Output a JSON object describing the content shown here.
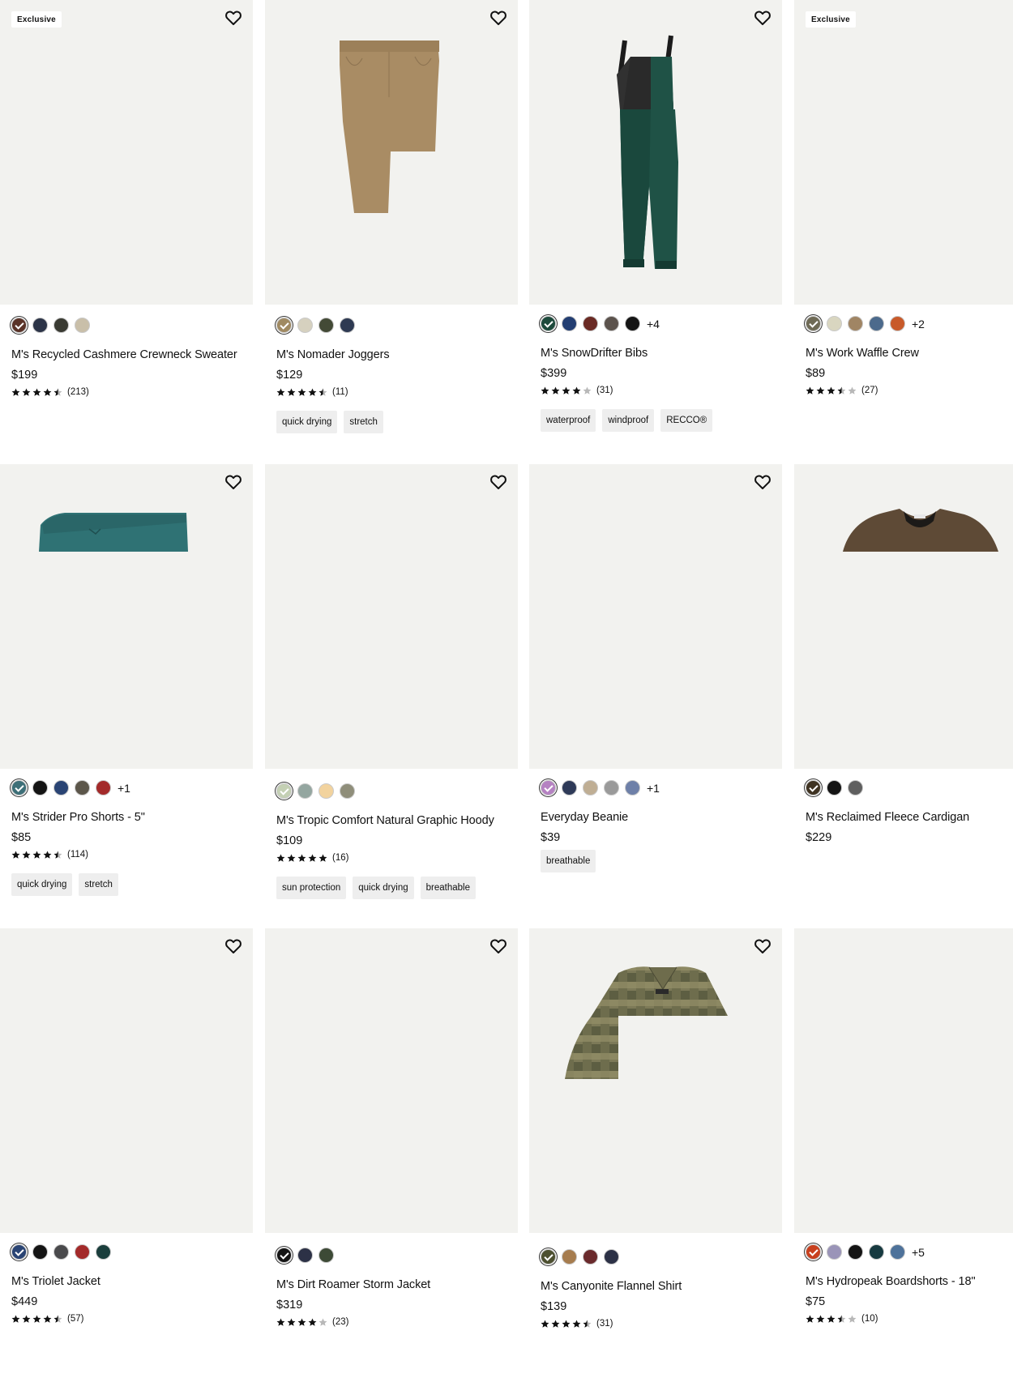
{
  "products": [
    {
      "badge": "Exclusive",
      "name": "M's Recycled Cashmere Crewneck Sweater",
      "price": "$199",
      "rating": 4.5,
      "review_count": "(213)",
      "swatches": [
        "#5a3328",
        "#2c3448",
        "#3a3b33",
        "#c9bfa9"
      ],
      "selected_swatch": 0,
      "more": "",
      "tags": [],
      "image": "none"
    },
    {
      "badge": "",
      "name": "M's Nomader Joggers",
      "price": "$129",
      "rating": 4.5,
      "review_count": "(11)",
      "swatches": [
        "#a08a62",
        "#d6d1bf",
        "#434a36",
        "#2e3a52"
      ],
      "selected_swatch": 0,
      "more": "",
      "tags": [
        "quick drying",
        "stretch"
      ],
      "image": "joggers"
    },
    {
      "badge": "",
      "name": "M's SnowDrifter Bibs",
      "price": "$399",
      "rating": 4,
      "review_count": "(31)",
      "swatches": [
        "#1d4a3c",
        "#233e72",
        "#6a2a24",
        "#5c534d",
        "#151515"
      ],
      "selected_swatch": 0,
      "more": "+4",
      "tags": [
        "waterproof",
        "windproof",
        "RECCO®"
      ],
      "image": "bibs"
    },
    {
      "badge": "Exclusive",
      "name": "M's Work Waffle Crew",
      "price": "$89",
      "rating": 3.5,
      "review_count": "(27)",
      "swatches": [
        "#6e6a55",
        "#d9d6c0",
        "#a08564",
        "#4c6a8c",
        "#c85a2a"
      ],
      "selected_swatch": 0,
      "more": "+2",
      "tags": [],
      "image": "none"
    },
    {
      "badge": "",
      "name": "M's Strider Pro Shorts - 5\"",
      "price": "$85",
      "rating": 4.5,
      "review_count": "(114)",
      "swatches": [
        "#3d6f78",
        "#141414",
        "#2a4474",
        "#5c564a",
        "#a32a2a"
      ],
      "selected_swatch": 0,
      "more": "+1",
      "tags": [
        "quick drying",
        "stretch"
      ],
      "image": "shorts"
    },
    {
      "badge": "",
      "name": "M's Tropic Comfort Natural Graphic Hoody",
      "price": "$109",
      "rating": 5,
      "review_count": "(16)",
      "swatches": [
        "#c4d0b4",
        "#94a6a0",
        "#f2d39e",
        "#8f8e7a"
      ],
      "selected_swatch": 0,
      "more": "",
      "tags": [
        "sun protection",
        "quick drying",
        "breathable"
      ],
      "image": "none"
    },
    {
      "badge": "",
      "name": "Everyday Beanie",
      "price": "$39",
      "rating": null,
      "review_count": "",
      "swatches": [
        "#b582c2",
        "#2e3a58",
        "#bfae94",
        "#9a9a9a",
        "#6e80a8"
      ],
      "selected_swatch": 0,
      "more": "+1",
      "tags": [
        "breathable"
      ],
      "image": "none"
    },
    {
      "badge": "",
      "name": "M's Reclaimed Fleece Cardigan",
      "price": "$229",
      "rating": null,
      "review_count": "",
      "swatches": [
        "#3f3322",
        "#141414",
        "#5f5f5f"
      ],
      "selected_swatch": 0,
      "more": "",
      "tags": [],
      "image": "cardigan"
    },
    {
      "badge": "",
      "name": "M's Triolet Jacket",
      "price": "$449",
      "rating": 4.5,
      "review_count": "(57)",
      "swatches": [
        "#2a4474",
        "#141414",
        "#4a4a4c",
        "#a32a2a",
        "#1a3e3c"
      ],
      "selected_swatch": 0,
      "more": "",
      "tags": [],
      "image": "none"
    },
    {
      "badge": "",
      "name": "M's Dirt Roamer Storm Jacket",
      "price": "$319",
      "rating": 4,
      "review_count": "(23)",
      "swatches": [
        "#141414",
        "#2c3146",
        "#3d4a36"
      ],
      "selected_swatch": 0,
      "more": "",
      "tags": [],
      "image": "none"
    },
    {
      "badge": "",
      "name": "M's Canyonite Flannel Shirt",
      "price": "$139",
      "rating": 4.5,
      "review_count": "(31)",
      "swatches": [
        "#4d5030",
        "#a67c4e",
        "#6a2a2c",
        "#2c3146"
      ],
      "selected_swatch": 0,
      "more": "",
      "tags": [],
      "image": "flannel"
    },
    {
      "badge": "",
      "name": "M's Hydropeak Boardshorts - 18\"",
      "price": "$75",
      "rating": 3.5,
      "review_count": "(10)",
      "swatches": [
        "#c8401e",
        "#9a94b8",
        "#141414",
        "#173a40",
        "#4e729a"
      ],
      "selected_swatch": 0,
      "more": "+5",
      "tags": [],
      "image": "none"
    }
  ]
}
